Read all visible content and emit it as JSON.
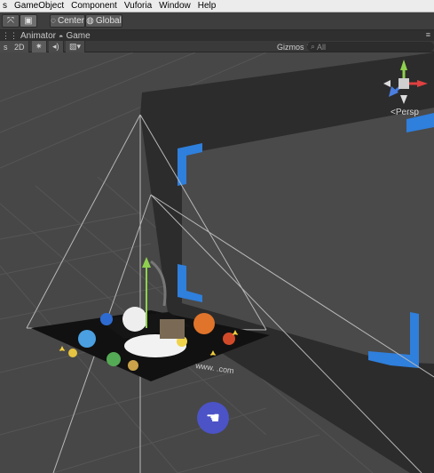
{
  "menu": [
    "s",
    "GameObject",
    "Component",
    "Vuforia",
    "Window",
    "Help"
  ],
  "toolbar": {
    "pivot_label": "Center",
    "space_label": "Global"
  },
  "tabs": {
    "animator": "Animator",
    "game": "Game"
  },
  "scene_toolbar": {
    "shading": "s",
    "mode_2d": "2D",
    "gizmos": "Gizmos",
    "search_placeholder": "All"
  },
  "scene": {
    "projection_label": "Persp",
    "watermark_text": "www.           .com",
    "accent_blue": "#2f7fdc",
    "cursor_color": "#4b53c6"
  }
}
